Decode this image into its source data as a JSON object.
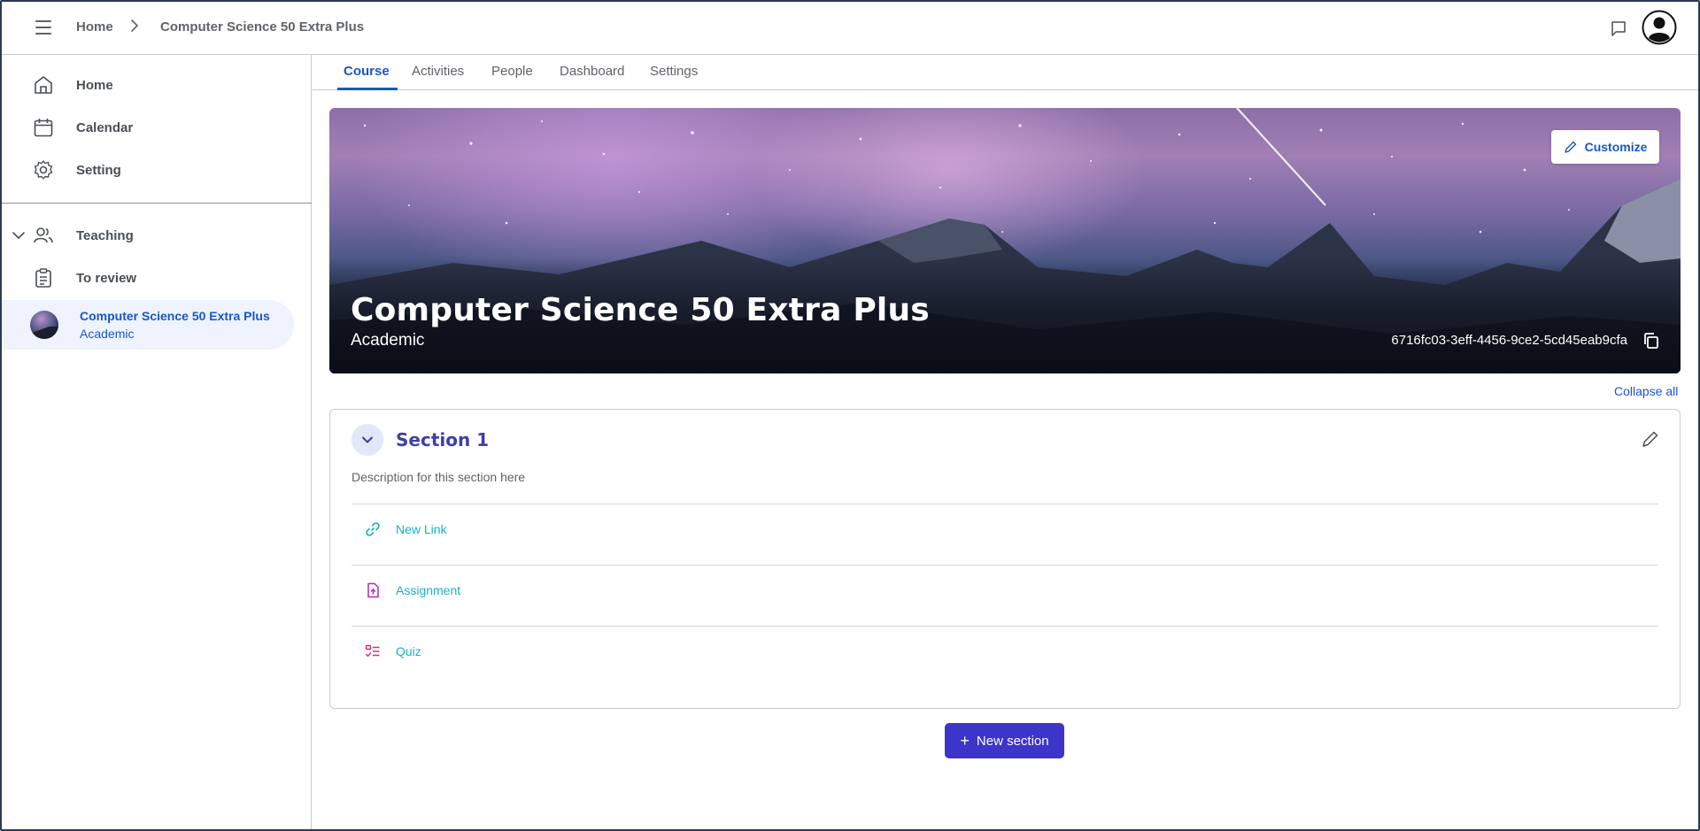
{
  "header": {
    "breadcrumb_home": "Home",
    "breadcrumb_current": "Computer Science 50 Extra Plus"
  },
  "sidebar": {
    "items": [
      {
        "label": "Home",
        "icon": "home-icon"
      },
      {
        "label": "Calendar",
        "icon": "calendar-icon"
      },
      {
        "label": "Setting",
        "icon": "gear-icon"
      },
      {
        "label": "Teaching",
        "icon": "people-icon"
      },
      {
        "label": "To review",
        "icon": "clipboard-icon"
      }
    ],
    "course": {
      "title": "Computer Science 50 Extra Plus",
      "subtitle": "Academic"
    }
  },
  "tabs": [
    {
      "label": "Course",
      "active": true
    },
    {
      "label": "Activities",
      "active": false
    },
    {
      "label": "People",
      "active": false
    },
    {
      "label": "Dashboard",
      "active": false
    },
    {
      "label": "Settings",
      "active": false
    }
  ],
  "banner": {
    "title": "Computer Science 50 Extra Plus",
    "subtitle": "Academic",
    "code": "6716fc03-3eff-4456-9ce2-5cd45eab9cfa",
    "customize_label": "Customize"
  },
  "collapse_all_label": "Collapse all",
  "section": {
    "title": "Section 1",
    "description": "Description for this section here",
    "activities": [
      {
        "label": "New Link",
        "icon": "link-icon",
        "color": "#19b0c8"
      },
      {
        "label": "Assignment",
        "icon": "file-upload-icon",
        "color": "#b028b8"
      },
      {
        "label": "Quiz",
        "icon": "quiz-list-icon",
        "color": "#d6287a"
      }
    ]
  },
  "new_section_label": "New section",
  "colors": {
    "accent": "#1a56c8",
    "primary_button": "#3d34c9",
    "section_title": "#3f3fa8",
    "activity_text": "#19b0c8"
  }
}
